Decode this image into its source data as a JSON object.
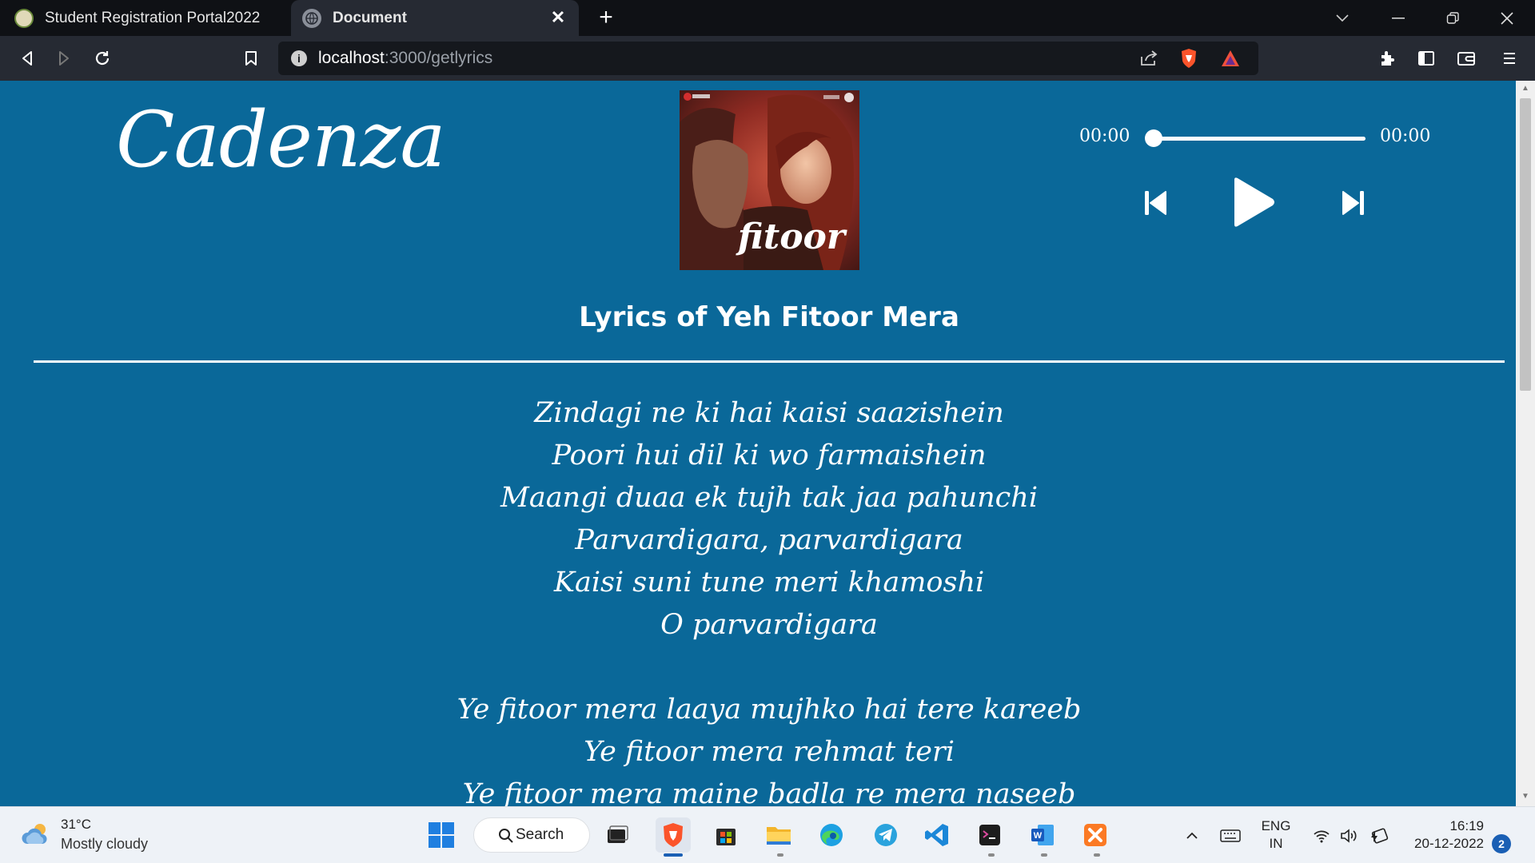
{
  "browser": {
    "tabs": [
      {
        "title": "Student Registration Portal2022",
        "active": false
      },
      {
        "title": "Document",
        "active": true
      }
    ],
    "new_tab_label": "+",
    "url_host": "localhost",
    "url_path": ":3000/getlyrics",
    "info_glyph": "i"
  },
  "app": {
    "logo": "Cadenza",
    "album_title": "fitoor",
    "player": {
      "current_time": "00:00",
      "duration": "00:00",
      "progress": 0
    },
    "lyrics_heading": "Lyrics of Yeh Fitoor Mera",
    "lyrics": [
      "Zindagi ne ki hai kaisi saazishein",
      "Poori hui dil ki wo farmaishein",
      "Maangi duaa ek tujh tak jaa pahunchi",
      "Parvardigara, parvardigara",
      "Kaisi suni tune meri khamoshi",
      "O parvardigara",
      "",
      "Ye fitoor mera laaya mujhko hai tere kareeb",
      "Ye fitoor mera rehmat teri",
      "Ye fitoor mera maine badla re mera naseeb"
    ]
  },
  "taskbar": {
    "weather_temp": "31°C",
    "weather_desc": "Mostly cloudy",
    "search_label": "Search",
    "lang_line1": "ENG",
    "lang_line2": "IN",
    "time": "16:19",
    "date": "20-12-2022",
    "notification_count": "2"
  },
  "colors": {
    "page_background": "#0a6899",
    "tab_strip": "#0f1115",
    "toolbar": "#262a33",
    "taskbar": "#eef2f7"
  }
}
